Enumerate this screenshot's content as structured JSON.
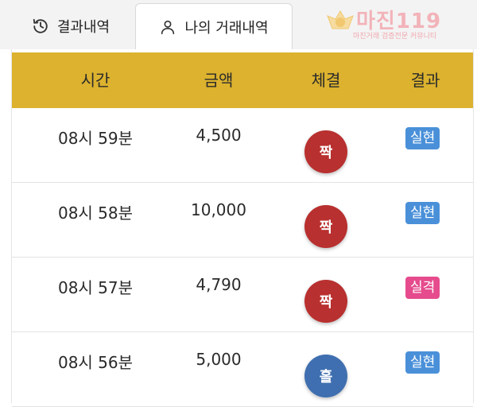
{
  "tabs": [
    {
      "label": "결과내역",
      "icon": "history-icon"
    },
    {
      "label": "나의 거래내역",
      "icon": "user-icon",
      "active": true
    }
  ],
  "watermark": {
    "title": "마진119",
    "subtitle": "마진거래 검증전문 커뮤니티"
  },
  "table": {
    "headers": [
      "시간",
      "금액",
      "체결",
      "결과"
    ],
    "rows": [
      {
        "time": "08시 59분",
        "amount": "4,500",
        "call": "짝",
        "call_color": "#b8302f",
        "result": "실현",
        "result_color": "#4a90d9"
      },
      {
        "time": "08시 58분",
        "amount": "10,000",
        "call": "짝",
        "call_color": "#b8302f",
        "result": "실현",
        "result_color": "#4a90d9"
      },
      {
        "time": "08시 57분",
        "amount": "4,790",
        "call": "짝",
        "call_color": "#b8302f",
        "result": "실격",
        "result_color": "#e54b8d"
      },
      {
        "time": "08시 56분",
        "amount": "5,000",
        "call": "홀",
        "call_color": "#3f6fb0",
        "result": "실현",
        "result_color": "#4a90d9"
      }
    ]
  },
  "colors": {
    "header_bg": "#dcb22e",
    "tabbar_bg": "#f3f3f3"
  }
}
